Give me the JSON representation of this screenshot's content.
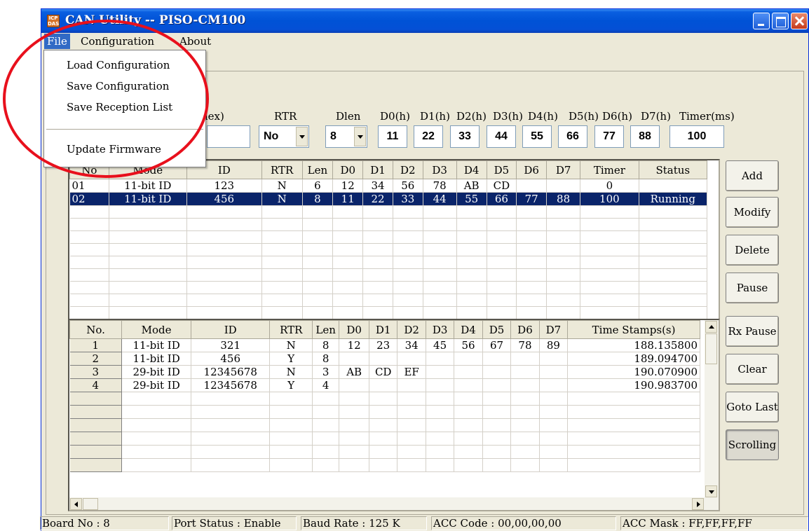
{
  "window": {
    "title": "CAN Utility -- PISO-CM100",
    "icon_text": "ICP DAS"
  },
  "menubar": {
    "items": [
      "File",
      "Configuration",
      "About"
    ]
  },
  "file_menu": {
    "items": [
      "Load Configuration",
      "Save Configuration",
      "Save Reception List",
      "Update Firmware"
    ]
  },
  "send_form": {
    "labels": {
      "id": "nex)",
      "rtr": "RTR",
      "dlen": "Dlen",
      "d0": "D0(h)",
      "d1": "D1(h)",
      "d2": "D2(h)",
      "d3": "D3(h)",
      "d4": "D4(h)",
      "d5": "D5(h)",
      "d6": "D6(h)",
      "d7": "D7(h)",
      "timer": "Timer(ms)"
    },
    "id_value": "",
    "rtr_value": "No",
    "dlen_value": "8",
    "data_values": [
      "11",
      "22",
      "33",
      "44",
      "55",
      "66",
      "77",
      "88"
    ],
    "timer_value": "100"
  },
  "send_list": {
    "columns": [
      "No",
      "Mode",
      "ID",
      "RTR",
      "Len",
      "D0",
      "D1",
      "D2",
      "D3",
      "D4",
      "D5",
      "D6",
      "D7",
      "Timer",
      "Status"
    ],
    "rows": [
      [
        "01",
        "11-bit ID",
        "123",
        "N",
        "6",
        "12",
        "34",
        "56",
        "78",
        "AB",
        "CD",
        "",
        "",
        "0",
        ""
      ],
      [
        "02",
        "11-bit ID",
        "456",
        "N",
        "8",
        "11",
        "22",
        "33",
        "44",
        "55",
        "66",
        "77",
        "88",
        "100",
        "Running"
      ]
    ],
    "selected_index": 1
  },
  "receive_list": {
    "columns": [
      "No.",
      "Mode",
      "ID",
      "RTR",
      "Len",
      "D0",
      "D1",
      "D2",
      "D3",
      "D4",
      "D5",
      "D6",
      "D7",
      "Time Stamps(s)"
    ],
    "rows": [
      [
        "1",
        "11-bit ID",
        "321",
        "N",
        "8",
        "12",
        "23",
        "34",
        "45",
        "56",
        "67",
        "78",
        "89",
        "188.135800"
      ],
      [
        "2",
        "11-bit ID",
        "456",
        "Y",
        "8",
        "",
        "",
        "",
        "",
        "",
        "",
        "",
        "",
        "189.094700"
      ],
      [
        "3",
        "29-bit ID",
        "12345678",
        "N",
        "3",
        "AB",
        "CD",
        "EF",
        "",
        "",
        "",
        "",
        "",
        "190.070900"
      ],
      [
        "4",
        "29-bit ID",
        "12345678",
        "Y",
        "4",
        "",
        "",
        "",
        "",
        "",
        "",
        "",
        "",
        "190.983700"
      ]
    ]
  },
  "buttons": {
    "add": "Add",
    "modify": "Modify",
    "delete": "Delete",
    "pause": "Pause",
    "rx_pause": "Rx Pause",
    "clear": "Clear",
    "goto_last": "Goto Last",
    "scrolling": "Scrolling"
  },
  "statusbar": {
    "board": "Board No : 8",
    "port": "Port Status : Enable",
    "baud": "Baud Rate : 125 K",
    "acc_code": "ACC Code : 00,00,00,00",
    "acc_mask": "ACC Mask : FF,FF,FF,FF"
  },
  "colors": {
    "annotation": "#e8101c",
    "selection": "#0a246a",
    "titlebar": "#0052d6"
  }
}
